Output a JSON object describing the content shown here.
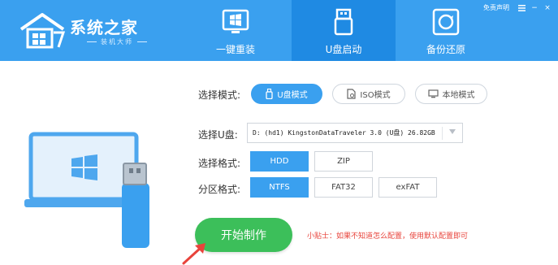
{
  "header": {
    "logo_title": "系统之家",
    "logo_subtitle": "装机大师",
    "tabs": [
      {
        "label": "一键重装",
        "icon": "windows-monitor-icon"
      },
      {
        "label": "U盘启动",
        "icon": "usb-drive-icon",
        "active": true
      },
      {
        "label": "备份还原",
        "icon": "backup-restore-icon"
      }
    ],
    "tools": {
      "disclaimer": "免责声明",
      "menu_icon": "menu-icon",
      "minimize": "−",
      "close": "×"
    }
  },
  "form": {
    "mode_label": "选择模式:",
    "modes": [
      {
        "label": "U盘模式",
        "icon": "usb-icon",
        "active": true
      },
      {
        "label": "ISO模式",
        "icon": "iso-file-icon",
        "active": false
      },
      {
        "label": "本地模式",
        "icon": "monitor-icon",
        "active": false
      }
    ],
    "drive_label": "选择U盘:",
    "drive_value": "D: (hd1) KingstonDataTraveler 3.0 (U盘) 26.82GB",
    "format_label": "选择格式:",
    "formats": [
      {
        "label": "HDD",
        "active": true
      },
      {
        "label": "ZIP",
        "active": false
      }
    ],
    "partition_label": "分区格式:",
    "partitions": [
      {
        "label": "NTFS",
        "active": true
      },
      {
        "label": "FAT32",
        "active": false
      },
      {
        "label": "exFAT",
        "active": false
      }
    ],
    "start_label": "开始制作",
    "tip": "小贴士：如果不知道怎么配置，使用默认配置即可"
  },
  "colors": {
    "header_bg": "#3aa0ef",
    "active_tab_bg": "#1f8ae3",
    "accent": "#3aa0ef",
    "start_button": "#3cbf5a",
    "tip_text": "#e8433b",
    "arrow": "#e8433b"
  }
}
